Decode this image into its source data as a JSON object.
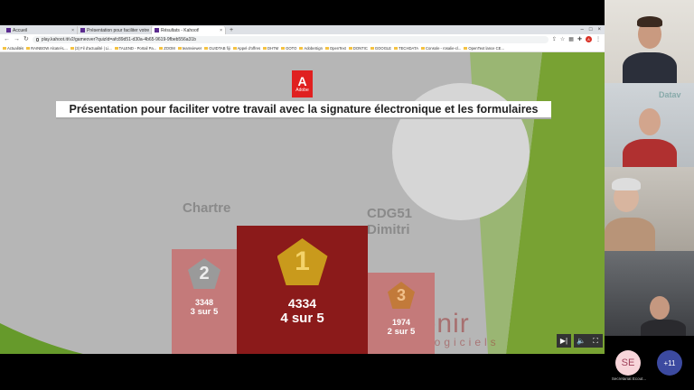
{
  "browser": {
    "tabs": [
      {
        "label": "Accueil"
      },
      {
        "label": "Présentation pour faciliter votre"
      },
      {
        "label": "Résultats - Kahoot!"
      }
    ],
    "url": "play.kahoot.it/v2/gameover?quizId=afc89d51-d30a-4b65-9619-9fbeb556a31b",
    "bookmarks": [
      "Actualités",
      "RAINBOW Alcatel-L...",
      "(3) Fil d'actualité | Li...",
      "TALEND - Portail Pa...",
      "ZOOM",
      "teamviewer",
      "GUIDTAB fiji",
      "Appel d'offres",
      "DHTM",
      "GOTO",
      "AdobeSign",
      "OpenText",
      "DONTIC",
      "GOOGLE",
      "TECHDATA",
      "Console - rosalie-cl...",
      "OpenText lance CE..."
    ]
  },
  "slide": {
    "logo": {
      "letter": "A",
      "text": "Adobe"
    },
    "title": "Présentation pour faciliter votre travail avec la signature électronique et les formulaires",
    "watermark": "atavenir",
    "watermark2": "logiciels"
  },
  "podium": {
    "first": {
      "rank": "1",
      "name_line1": "",
      "score": "4334",
      "correct": "4 sur 5"
    },
    "second": {
      "rank": "2",
      "name_line1": "Chartre",
      "score": "3348",
      "correct": "3 sur 5"
    },
    "third": {
      "rank": "3",
      "name_line1": "CDG51",
      "name_line2": "Dimitri",
      "score": "1974",
      "correct": "2 sur 5"
    }
  },
  "controls": {
    "skip": "▶|",
    "volume": "🔈",
    "fullscreen": "⛶"
  },
  "participants": {
    "self_initials": "SE",
    "self_name": "Secretariat Ecout...",
    "more": "+11",
    "tile2_logo": "Datav"
  },
  "colors": {
    "podium_first": "#8b1a1a",
    "podium_other": "#c47a7a",
    "adobe_red": "#e02020",
    "green_accent": "#7ab834"
  }
}
